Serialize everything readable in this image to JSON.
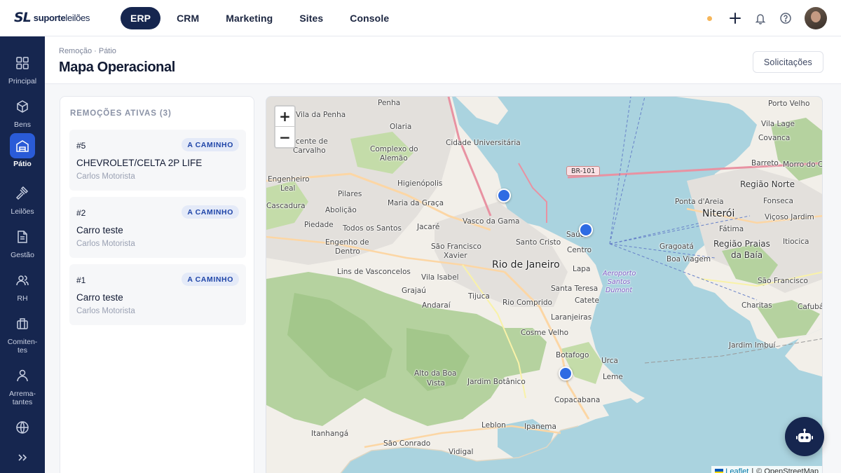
{
  "brand": {
    "mark": "SL",
    "name_bold": "suporte",
    "name_rest": "leilões"
  },
  "topnav": [
    {
      "label": "ERP",
      "active": true
    },
    {
      "label": "CRM",
      "active": false
    },
    {
      "label": "Marketing",
      "active": false
    },
    {
      "label": "Sites",
      "active": false
    },
    {
      "label": "Console",
      "active": false
    }
  ],
  "top_actions": {
    "status_color": "#f6b65a",
    "icons": [
      "plus-icon",
      "bell-icon",
      "help-icon"
    ]
  },
  "sidebar": [
    {
      "label": "Principal",
      "icon": "grid-icon",
      "active": false
    },
    {
      "label": "Bens",
      "icon": "box-icon",
      "active": false
    },
    {
      "label": "Pátio",
      "icon": "warehouse-icon",
      "active": true
    },
    {
      "label": "Leilões",
      "icon": "gavel-icon",
      "active": false
    },
    {
      "label": "Gestão",
      "icon": "document-icon",
      "active": false
    },
    {
      "label": "RH",
      "icon": "users-icon",
      "active": false
    },
    {
      "label": "Comiten-\ntes",
      "icon": "briefcase-icon",
      "active": false
    },
    {
      "label": "Arrema-\ntantes",
      "icon": "user-icon",
      "active": false
    },
    {
      "label": "",
      "icon": "globe-icon",
      "active": false
    }
  ],
  "header": {
    "breadcrumb": "Remoção · Pátio",
    "title": "Mapa Operacional",
    "requests_button": "Solicitações"
  },
  "panel": {
    "title": "REMOÇÕES ATIVAS (3)",
    "cards": [
      {
        "id": "#5",
        "status": "A CAMINHO",
        "vehicle": "CHEVROLET/CELTA 2P LIFE",
        "driver": "Carlos Motorista"
      },
      {
        "id": "#2",
        "status": "A CAMINHO",
        "vehicle": "Carro teste",
        "driver": "Carlos Motorista"
      },
      {
        "id": "#1",
        "status": "A CAMINHO",
        "vehicle": "Carro teste",
        "driver": "Carlos Motorista"
      }
    ]
  },
  "map": {
    "zoom_in": "+",
    "zoom_out": "−",
    "labels": {
      "vila_penha": "Vila da Penha",
      "penha": "Penha",
      "porto_velho": "Porto Velho",
      "olaria": "Olaria",
      "vila_lage": "Vila Lage",
      "vicente": "Vicente de",
      "carvalho": "Carvalho",
      "complexo": "Complexo do",
      "alemao": "Alemão",
      "cidade_univ": "Cidade Universitária",
      "covanca": "Covanca",
      "barreto": "Barreto",
      "mocangue": "Morro do Cr",
      "engenheiro": "Engenheiro",
      "leal": "Leal",
      "higienopolis": "Higienópolis",
      "pilares": "Pilares",
      "regiao_norte": "Região Norte",
      "cascadura": "Cascadura",
      "abolicao": "Abolição",
      "maria_graca": "Maria da Graça",
      "ponta_areia": "Ponta d'Areia",
      "fonseca": "Fonseca",
      "niteroi": "Niterói",
      "piedade": "Piedade",
      "todos_santos": "Todos os Santos",
      "jacare": "Jacaré",
      "vasco": "Vasco da Gama",
      "saude": "Saúde",
      "fatima": "Fátima",
      "vicoso": "Viçoso Jardim",
      "engenho": "Engenho de",
      "dentro": "Dentro",
      "santo_cristo": "Santo Cristo",
      "centro": "Centro",
      "gragoata": "Gragoatá",
      "regiao_praias": "Região Praias",
      "da_baia": "da Baía",
      "itiocica": "Itiocica",
      "sao_francisco": "São Francisco",
      "xavier": "Xavier",
      "boa_viagem": "Boa Viagem",
      "lins": "Lins de Vasconcelos",
      "rio": "Rio de Janeiro",
      "lapa": "Lapa",
      "vila_isabel": "Vila Isabel",
      "aeroporto": "Aeroporto",
      "santos_dumont": "Santos",
      "dumont": "Dumont",
      "sao_francisco_nit": "São Francisco",
      "santa_teresa": "Santa Teresa",
      "grajau": "Grajaú",
      "tijuca": "Tijuca",
      "catete": "Catete",
      "charitas": "Charitas",
      "cafuba": "Cafubá",
      "andarai": "Andaraí",
      "rio_comprido": "Rio Comprido",
      "laranjeiras": "Laranjeiras",
      "cosme_velho": "Cosme Velho",
      "jardim_imbui": "Jardim Imbuí",
      "botafogo": "Botafogo",
      "urca": "Urca",
      "alto_boa": "Alto da Boa",
      "vista": "Vista",
      "jardim_botanico": "Jardim Botânico",
      "leme": "Leme",
      "copacabana": "Copacabana",
      "leblon": "Leblon",
      "ipanema": "Ipanema",
      "itanhanga": "Itanhangá",
      "sao_conrado": "São Conrado",
      "vidigal": "Vidigal"
    },
    "roads": {
      "br101": "BR-101"
    },
    "attribution": {
      "leaflet": "Leaflet",
      "separator": "|",
      "osm": "© OpenStreetMap"
    }
  },
  "assistant": {
    "icon": "robot-icon"
  }
}
